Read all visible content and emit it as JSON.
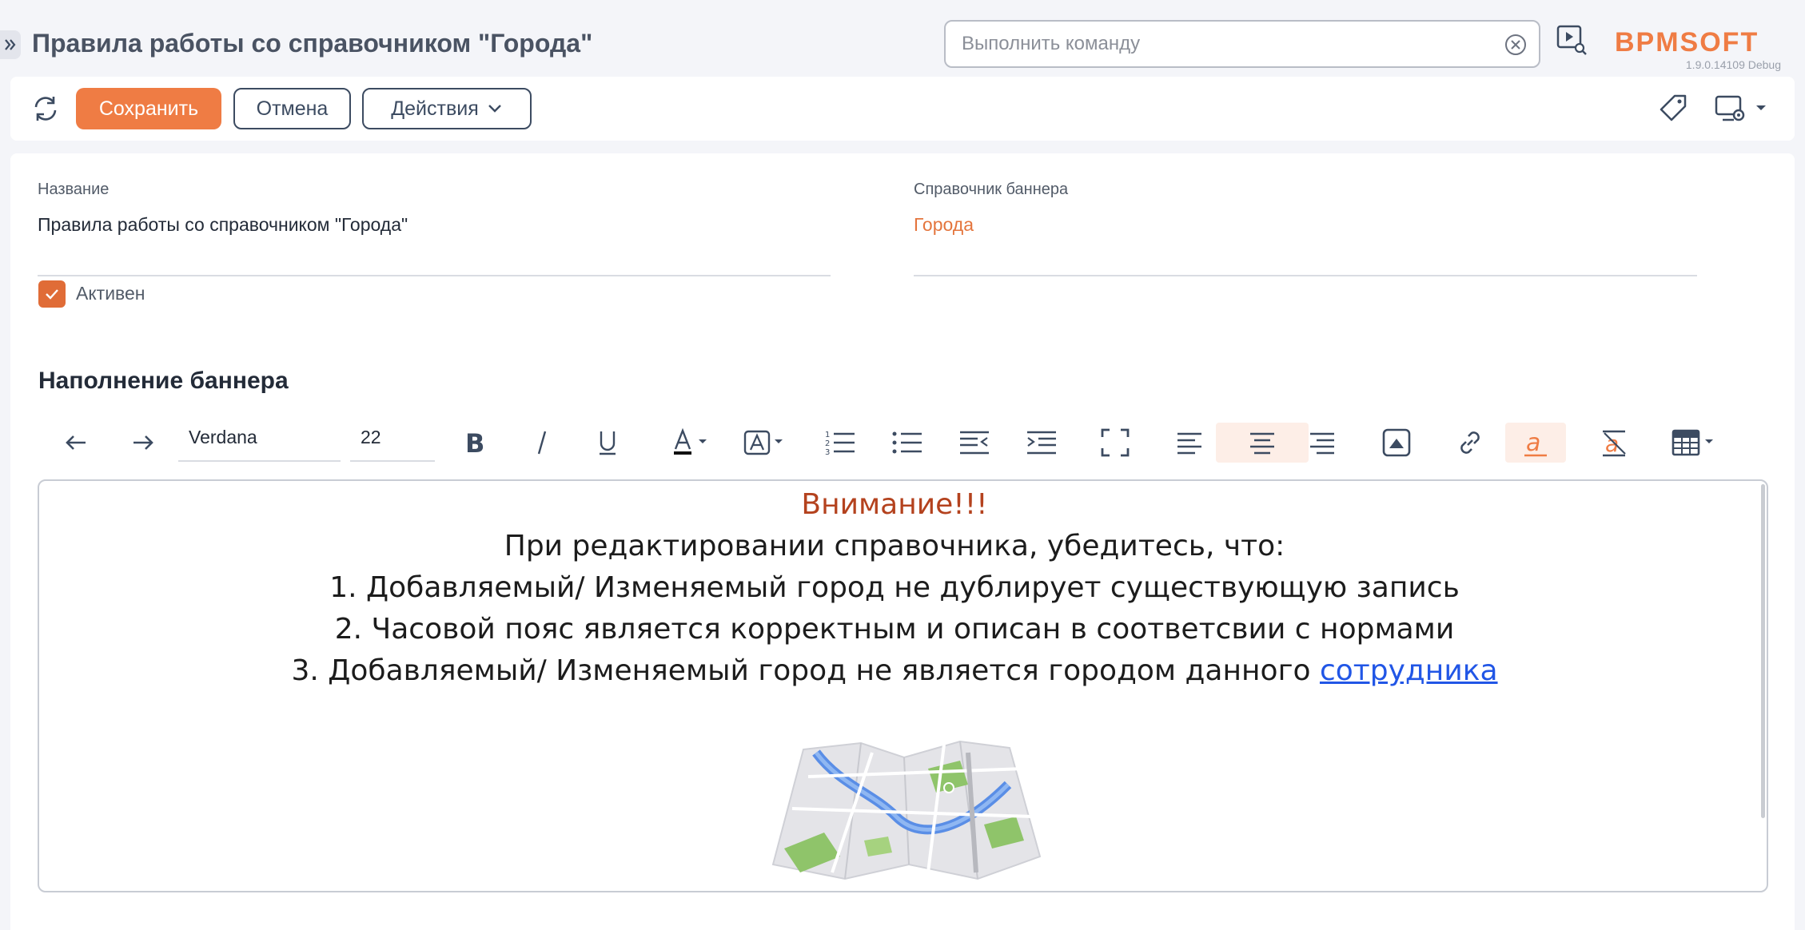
{
  "header": {
    "page_title": "Правила работы со справочником \"Города\"",
    "command_placeholder": "Выполнить команду",
    "logo_text": "BPMSOFT",
    "version": "1.9.0.14109 Debug"
  },
  "toolbar": {
    "save_label": "Сохранить",
    "cancel_label": "Отмена",
    "actions_label": "Действия"
  },
  "form": {
    "name_label": "Название",
    "name_value": "Правила работы со справочником \"Города\"",
    "lookup_label": "Справочник баннера",
    "lookup_value": "Города",
    "active_label": "Активен",
    "active_checked": true,
    "section_title": "Наполнение баннера"
  },
  "editor": {
    "font_family": "Verdana",
    "font_size": "22",
    "content": {
      "line1": "Внимание!!!",
      "line2": "При редактировании справочника, убедитесь, что:",
      "line3": "1. Добавляемый/ Изменяемый город не дублирует существующую запись",
      "line4": "2. Часовой пояс является корректным и описан в соответсвии с нормами",
      "line5_text": "3. Добавляемый/ Изменяемый город не является городом данного ",
      "line5_link": "сотрудника"
    }
  },
  "colors": {
    "accent": "#ef7c44",
    "checkbox": "#e06c37",
    "link": "#2156e6",
    "warning_text": "#b4421e",
    "lookup_value": "#e4753d"
  },
  "icons": [
    "expand-icon",
    "clear-icon",
    "video-search-icon",
    "refresh-icon",
    "chevron-down-icon",
    "tag-icon",
    "screen-settings-icon",
    "undo-icon",
    "redo-icon",
    "bold-icon",
    "italic-icon",
    "underline-icon",
    "font-color-icon",
    "background-color-icon",
    "numbered-list-icon",
    "bullet-list-icon",
    "outdent-icon",
    "indent-icon",
    "fullscreen-icon",
    "align-left-icon",
    "align-center-icon",
    "align-right-icon",
    "image-icon",
    "link-icon",
    "text-highlight-icon",
    "clear-format-icon",
    "table-icon",
    "map-image"
  ]
}
